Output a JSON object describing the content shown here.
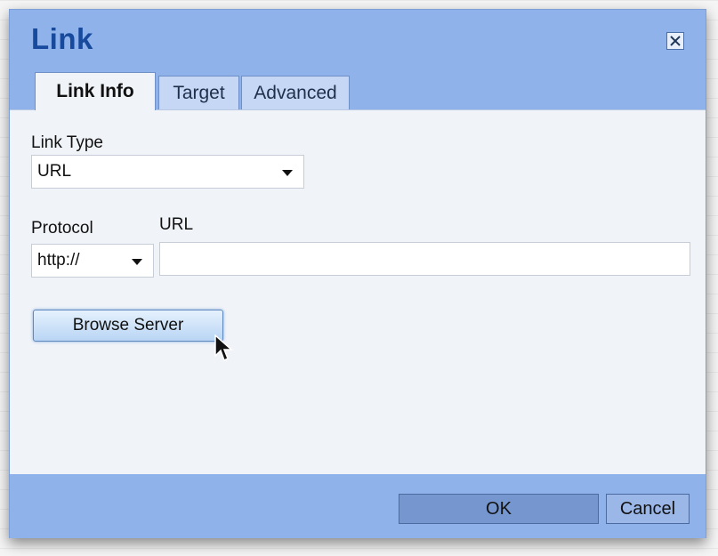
{
  "dialog": {
    "title": "Link",
    "close_icon": "close-icon"
  },
  "tabs": [
    {
      "label": "Link Info",
      "active": true
    },
    {
      "label": "Target",
      "active": false
    },
    {
      "label": "Advanced",
      "active": false
    }
  ],
  "form": {
    "link_type_label": "Link Type",
    "link_type_value": "URL",
    "protocol_label": "Protocol",
    "protocol_value": "http://",
    "url_label": "URL",
    "url_value": "",
    "browse_label": "Browse Server"
  },
  "footer": {
    "ok_label": "OK",
    "cancel_label": "Cancel"
  },
  "colors": {
    "chrome": "#8fb2ea",
    "title": "#174a9c",
    "panel": "#f0f3f8"
  }
}
